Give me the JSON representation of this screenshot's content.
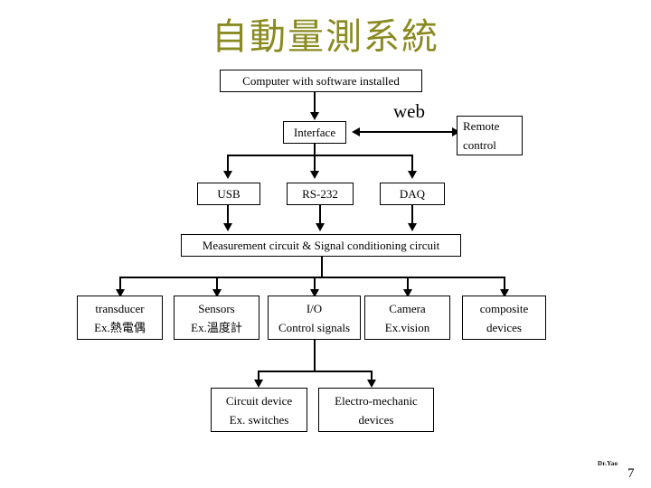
{
  "slide": {
    "title": "自動量測系統",
    "title_color": "#8a8a22",
    "page_number": "7",
    "credit": "Dr.Yao",
    "background": "#ffffff",
    "line_color": "#000000"
  },
  "diagram": {
    "type": "flowchart",
    "nodes": {
      "computer": {
        "label": "Computer with software installed"
      },
      "interface": {
        "label": "Interface"
      },
      "remote_control": {
        "line1": "Remote",
        "line2": "control"
      },
      "web_link": {
        "label": "web"
      },
      "usb": {
        "label": "USB"
      },
      "rs232": {
        "label": "RS-232"
      },
      "daq": {
        "label": "DAQ"
      },
      "measurement": {
        "label": "Measurement circuit & Signal conditioning circuit"
      },
      "transducer": {
        "line1": "transducer",
        "line2": "Ex.熱電偶"
      },
      "sensors": {
        "line1": "Sensors",
        "line2": "Ex.溫度計"
      },
      "io": {
        "line1": "I/O",
        "line2": "Control signals"
      },
      "camera": {
        "line1": "Camera",
        "line2": "Ex.vision"
      },
      "composite": {
        "line1": "composite",
        "line2": "devices"
      },
      "circuit_device": {
        "line1": "Circuit device",
        "line2": "Ex. switches"
      },
      "electro_mechanic": {
        "line1": "Electro-mechanic",
        "line2": "devices"
      }
    }
  }
}
